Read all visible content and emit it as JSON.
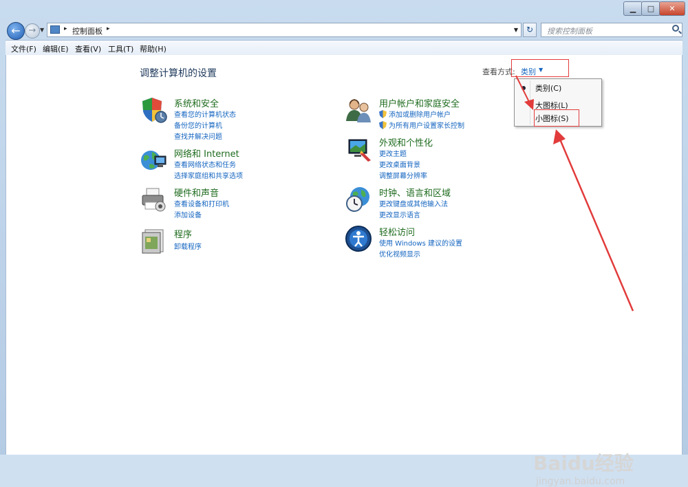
{
  "window": {
    "minimize_icon": "minimize-icon",
    "maximize_icon": "maximize-icon",
    "close_icon": "close-icon"
  },
  "address": {
    "breadcrumb": "控制面板",
    "separator": "▸",
    "search_placeholder": "搜索控制面板"
  },
  "menu": {
    "items": [
      "文件(F)",
      "编辑(E)",
      "查看(V)",
      "工具(T)",
      "帮助(H)"
    ]
  },
  "main": {
    "title": "调整计算机的设置",
    "view_by_label": "查看方式:",
    "view_by_value": "类别",
    "dropdown": {
      "options": [
        "类别(C)",
        "大图标(L)",
        "小图标(S)"
      ],
      "selected": "类别(C)"
    },
    "categories_left": [
      {
        "title": "系统和安全",
        "icon": "shield-icon",
        "links": [
          "查看您的计算机状态",
          "备份您的计算机",
          "查找并解决问题"
        ]
      },
      {
        "title": "网络和 Internet",
        "icon": "network-globe-icon",
        "links": [
          "查看网络状态和任务",
          "选择家庭组和共享选项"
        ]
      },
      {
        "title": "硬件和声音",
        "icon": "printer-icon",
        "links": [
          "查看设备和打印机",
          "添加设备"
        ]
      },
      {
        "title": "程序",
        "icon": "programs-icon",
        "links": [
          "卸载程序"
        ]
      }
    ],
    "categories_right": [
      {
        "title": "用户帐户和家庭安全",
        "icon": "users-icon",
        "links": [
          "添加或删除用户帐户",
          "为所有用户设置家长控制"
        ]
      },
      {
        "title": "外观和个性化",
        "icon": "appearance-icon",
        "links": [
          "更改主题",
          "更改桌面背景",
          "调整屏幕分辨率"
        ]
      },
      {
        "title": "时钟、语言和区域",
        "icon": "clock-globe-icon",
        "links": [
          "更改键盘或其他输入法",
          "更改显示语言"
        ]
      },
      {
        "title": "轻松访问",
        "icon": "ease-of-access-icon",
        "links": [
          "使用 Windows 建议的设置",
          "优化视频显示"
        ]
      }
    ]
  },
  "watermark": {
    "brand": "Baidu经验",
    "url": "jingyan.baidu.com"
  },
  "colors": {
    "link": "#1565c0",
    "category_title": "#1e6b1e",
    "annotation": "#e23b3b"
  }
}
